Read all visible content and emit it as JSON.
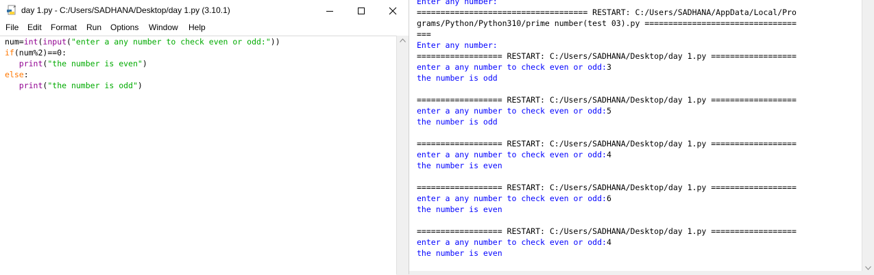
{
  "editor": {
    "title": "day 1.py - C:/Users/SADHANA/Desktop/day 1.py (3.10.1)",
    "menu": [
      "File",
      "Edit",
      "Format",
      "Run",
      "Options",
      "Window",
      "Help"
    ],
    "code": {
      "l1": {
        "a": "num=",
        "b": "int",
        "c": "(",
        "d": "input",
        "e": "(",
        "f": "\"enter a any number to check even or odd:\"",
        "g": "))"
      },
      "l2": {
        "a": "if",
        "b": "(num%2)==0:"
      },
      "l3": {
        "a": "   ",
        "b": "print",
        "c": "(",
        "d": "\"the number is even\"",
        "e": ")"
      },
      "l4": {
        "a": "else",
        "b": ":"
      },
      "l5": {
        "a": "   ",
        "b": "print",
        "c": "(",
        "d": "\"the number is odd\"",
        "e": ")"
      }
    }
  },
  "shell": {
    "lines": [
      {
        "text": "Enter any number:",
        "color": "blue"
      },
      {
        "text": "==================================== RESTART: C:/Users/SADHANA/AppData/Local/Pro",
        "color": "black"
      },
      {
        "text": "grams/Python/Python310/prime number(test 03).py ================================",
        "color": "black"
      },
      {
        "text": "===",
        "color": "black"
      },
      {
        "text": "Enter any number:",
        "color": "blue"
      },
      {
        "text": "================== RESTART: C:/Users/SADHANA/Desktop/day 1.py ==================",
        "color": "black"
      },
      {
        "prompt": "enter a any number to check even or odd:",
        "value": "3"
      },
      {
        "text": "the number is odd",
        "color": "blue"
      },
      {
        "text": "",
        "color": "black"
      },
      {
        "text": "================== RESTART: C:/Users/SADHANA/Desktop/day 1.py ==================",
        "color": "black"
      },
      {
        "prompt": "enter a any number to check even or odd:",
        "value": "5"
      },
      {
        "text": "the number is odd",
        "color": "blue"
      },
      {
        "text": "",
        "color": "black"
      },
      {
        "text": "================== RESTART: C:/Users/SADHANA/Desktop/day 1.py ==================",
        "color": "black"
      },
      {
        "prompt": "enter a any number to check even or odd:",
        "value": "4"
      },
      {
        "text": "the number is even",
        "color": "blue"
      },
      {
        "text": "",
        "color": "black"
      },
      {
        "text": "================== RESTART: C:/Users/SADHANA/Desktop/day 1.py ==================",
        "color": "black"
      },
      {
        "prompt": "enter a any number to check even or odd:",
        "value": "6"
      },
      {
        "text": "the number is even",
        "color": "blue"
      },
      {
        "text": "",
        "color": "black"
      },
      {
        "text": "================== RESTART: C:/Users/SADHANA/Desktop/day 1.py ==================",
        "color": "black"
      },
      {
        "prompt": "enter a any number to check even or odd:",
        "value": "4"
      },
      {
        "text": "the number is even",
        "color": "blue"
      }
    ]
  },
  "icons": {
    "app": "python-file-icon",
    "minimize": "minimize-icon",
    "maximize": "maximize-icon",
    "close": "close-icon",
    "scroll_up": "chevron-up-icon",
    "scroll_down": "chevron-down-icon"
  }
}
